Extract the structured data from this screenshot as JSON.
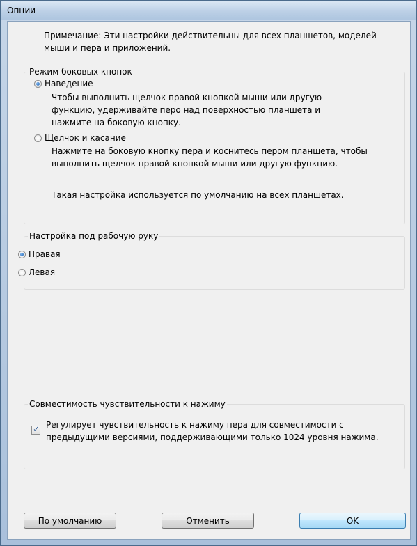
{
  "window": {
    "title": "Опции"
  },
  "note": "Примечание: Эти настройки действительны для всех планшетов, моделей мыши и пера и приложений.",
  "side_button_mode": {
    "label": "Режим боковых кнопок",
    "options": [
      {
        "label": "Наведение",
        "checked": true,
        "description": "Чтобы выполнить щелчок правой кнопкой мыши или другую функцию, удерживайте перо над поверхностью планшета и нажмите на боковую кнопку."
      },
      {
        "label": "Щелчок и касание",
        "checked": false,
        "description": "Нажмите на боковую кнопку пера и коснитесь пером планшета, чтобы выполнить щелчок правой кнопкой мыши или другую функцию.",
        "extra": "Такая настройка используется по умолчанию на всех планшетах."
      }
    ]
  },
  "handedness": {
    "label": "Настройка под рабочую руку",
    "options": [
      {
        "label": "Правая",
        "checked": true
      },
      {
        "label": "Левая",
        "checked": false
      }
    ]
  },
  "pressure_compat": {
    "label": "Совместимость чувствительности к нажиму",
    "checkbox_label": "Регулирует чувствительность к нажиму пера для совместимости с предыдущими версиями, поддерживающими только 1024 уровня нажима.",
    "checked": true
  },
  "buttons": {
    "default": "По умолчанию",
    "cancel": "Отменить",
    "ok": "OK"
  },
  "colors": {
    "title_bar": "#bcd0e6",
    "client_bg": "#f0f0f0",
    "radio_accent": "#1b5fae",
    "default_button": "#3c7fb1"
  }
}
